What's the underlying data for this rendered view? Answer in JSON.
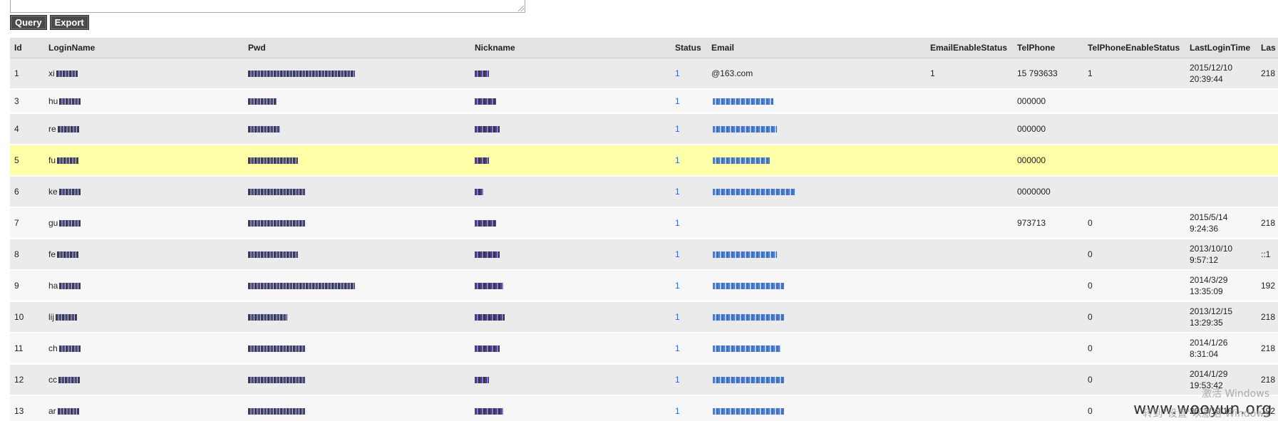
{
  "toolbar": {
    "query_label": "Query",
    "export_label": "Export"
  },
  "table": {
    "columns": [
      "Id",
      "LoginName",
      "Pwd",
      "Nickname",
      "Status",
      "Email",
      "EmailEnableStatus",
      "TelPhone",
      "TelPhoneEnableStatus",
      "LastLoginTime",
      "Las"
    ],
    "rows": [
      {
        "id": "1",
        "login": "xi",
        "status": "1",
        "email": "@163.com",
        "email_enable": "1",
        "tel": "15   793633",
        "tel_enable": "1",
        "last_login_date": "2015/12/10",
        "last_login_time": "20:39:44",
        "last_ip": "218"
      },
      {
        "id": "3",
        "login": "hu",
        "status": "1",
        "email": "",
        "email_enable": "",
        "tel": "000000",
        "tel_enable": "",
        "last_login_date": "",
        "last_login_time": "",
        "last_ip": ""
      },
      {
        "id": "4",
        "login": "re",
        "status": "1",
        "email": "",
        "email_enable": "",
        "tel": "000000",
        "tel_enable": "",
        "last_login_date": "",
        "last_login_time": "",
        "last_ip": ""
      },
      {
        "id": "5",
        "login": "fu",
        "status": "1",
        "email": "",
        "email_enable": "",
        "tel": "000000",
        "tel_enable": "",
        "last_login_date": "",
        "last_login_time": "",
        "last_ip": ""
      },
      {
        "id": "6",
        "login": "ke",
        "status": "1",
        "email": "",
        "email_enable": "",
        "tel": "0000000",
        "tel_enable": "",
        "last_login_date": "",
        "last_login_time": "",
        "last_ip": ""
      },
      {
        "id": "7",
        "login": "gu",
        "status": "1",
        "email": "",
        "email_enable": "",
        "tel": "973713",
        "tel_enable": "0",
        "last_login_date": "2015/5/14",
        "last_login_time": "9:24:36",
        "last_ip": "218"
      },
      {
        "id": "8",
        "login": "fe",
        "status": "1",
        "email": "",
        "email_enable": "",
        "tel": "",
        "tel_enable": "0",
        "last_login_date": "2013/10/10",
        "last_login_time": "9:57:12",
        "last_ip": "::1"
      },
      {
        "id": "9",
        "login": "ha",
        "status": "1",
        "email": "",
        "email_enable": "",
        "tel": "",
        "tel_enable": "0",
        "last_login_date": "2014/3/29",
        "last_login_time": "13:35:09",
        "last_ip": "192"
      },
      {
        "id": "10",
        "login": "lij",
        "status": "1",
        "email": "",
        "email_enable": "",
        "tel": "",
        "tel_enable": "0",
        "last_login_date": "2013/12/15",
        "last_login_time": "13:29:35",
        "last_ip": "218"
      },
      {
        "id": "11",
        "login": "ch",
        "status": "1",
        "email": "",
        "email_enable": "",
        "tel": "",
        "tel_enable": "0",
        "last_login_date": "2014/1/26",
        "last_login_time": "8:31:04",
        "last_ip": "218"
      },
      {
        "id": "12",
        "login": "cc",
        "status": "1",
        "email": "",
        "email_enable": "",
        "tel": "",
        "tel_enable": "0",
        "last_login_date": "2014/1/29",
        "last_login_time": "19:53:42",
        "last_ip": "218"
      },
      {
        "id": "13",
        "login": "ar",
        "status": "1",
        "email": "",
        "email_enable": "",
        "tel": "",
        "tel_enable": "0",
        "last_login_date": "2013/10/10",
        "last_login_time": "",
        "last_ip": "192"
      }
    ]
  },
  "watermark": {
    "site": "www.wooyun.org",
    "activate_line1": "激活 Windows",
    "activate_line2": "转到\"设置\"以激活 Windows"
  },
  "colors": {
    "highlight_row": "#ffffaa",
    "header_bg": "#e3e3e3",
    "button_bg": "#4a4a4a"
  }
}
